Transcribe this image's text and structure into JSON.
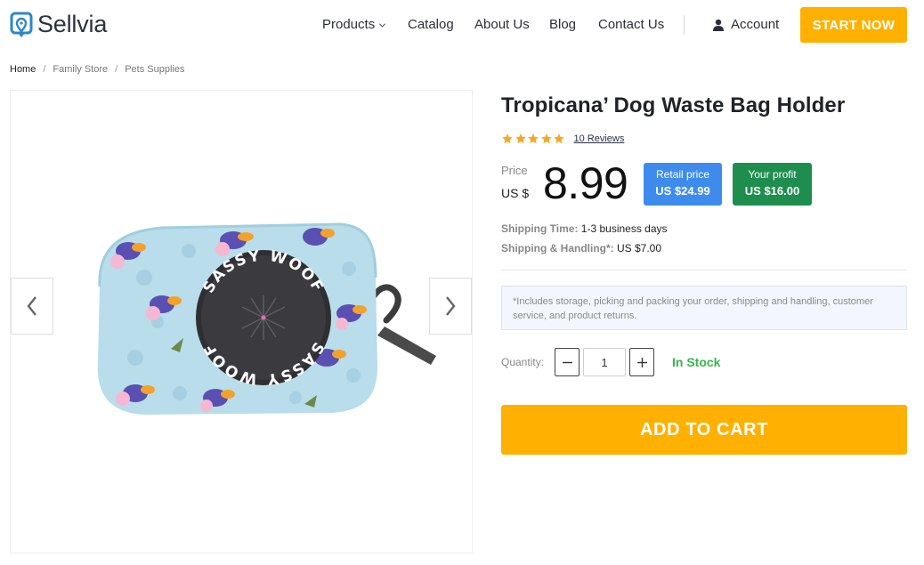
{
  "header": {
    "logo_text": "Sellvia",
    "nav": {
      "products": "Products",
      "catalog": "Catalog",
      "about": "About Us",
      "blog": "Blog",
      "contact": "Contact Us"
    },
    "account": "Account",
    "cta": "START NOW"
  },
  "breadcrumb": [
    "Home",
    "Family Store",
    "Pets Supplies"
  ],
  "breadcrumb_separator": "/",
  "product": {
    "title": "Tropicana’ Dog Waste Bag Holder",
    "rating_stars": 5,
    "reviews_label": "10 Reviews",
    "price_label": "Price",
    "currency": "US $",
    "price": "8.99",
    "retail": {
      "label": "Retail price",
      "value": "US $24.99"
    },
    "profit": {
      "label": "Your profit",
      "value": "US $16.00"
    },
    "shipping_time": {
      "label": "Shipping Time:",
      "value": "1-3 business days"
    },
    "shipping_handling": {
      "label": "Shipping & Handling*:",
      "value": "US $7.00"
    },
    "notice": "*Includes storage, picking and packing your order, shipping and handling, customer service, and product returns.",
    "quantity_label": "Quantity:",
    "quantity_value": "1",
    "stock_status": "In Stock",
    "add_to_cart": "ADD TO CART",
    "image_print_text": "SASSY WOOF"
  },
  "colors": {
    "accent": "#ffb000",
    "retail_badge": "#3d8ced",
    "profit_badge": "#1e8e4e",
    "in_stock": "#38b44a",
    "star": "#f5a623",
    "logo": "#2f86c8"
  },
  "icons": {
    "logo": "map-pin-icon",
    "products_dropdown": "chevron-down-icon",
    "account": "user-icon",
    "prev": "chevron-left-icon",
    "next": "chevron-right-icon",
    "minus": "minus-icon",
    "plus": "plus-icon",
    "star": "star-icon"
  }
}
